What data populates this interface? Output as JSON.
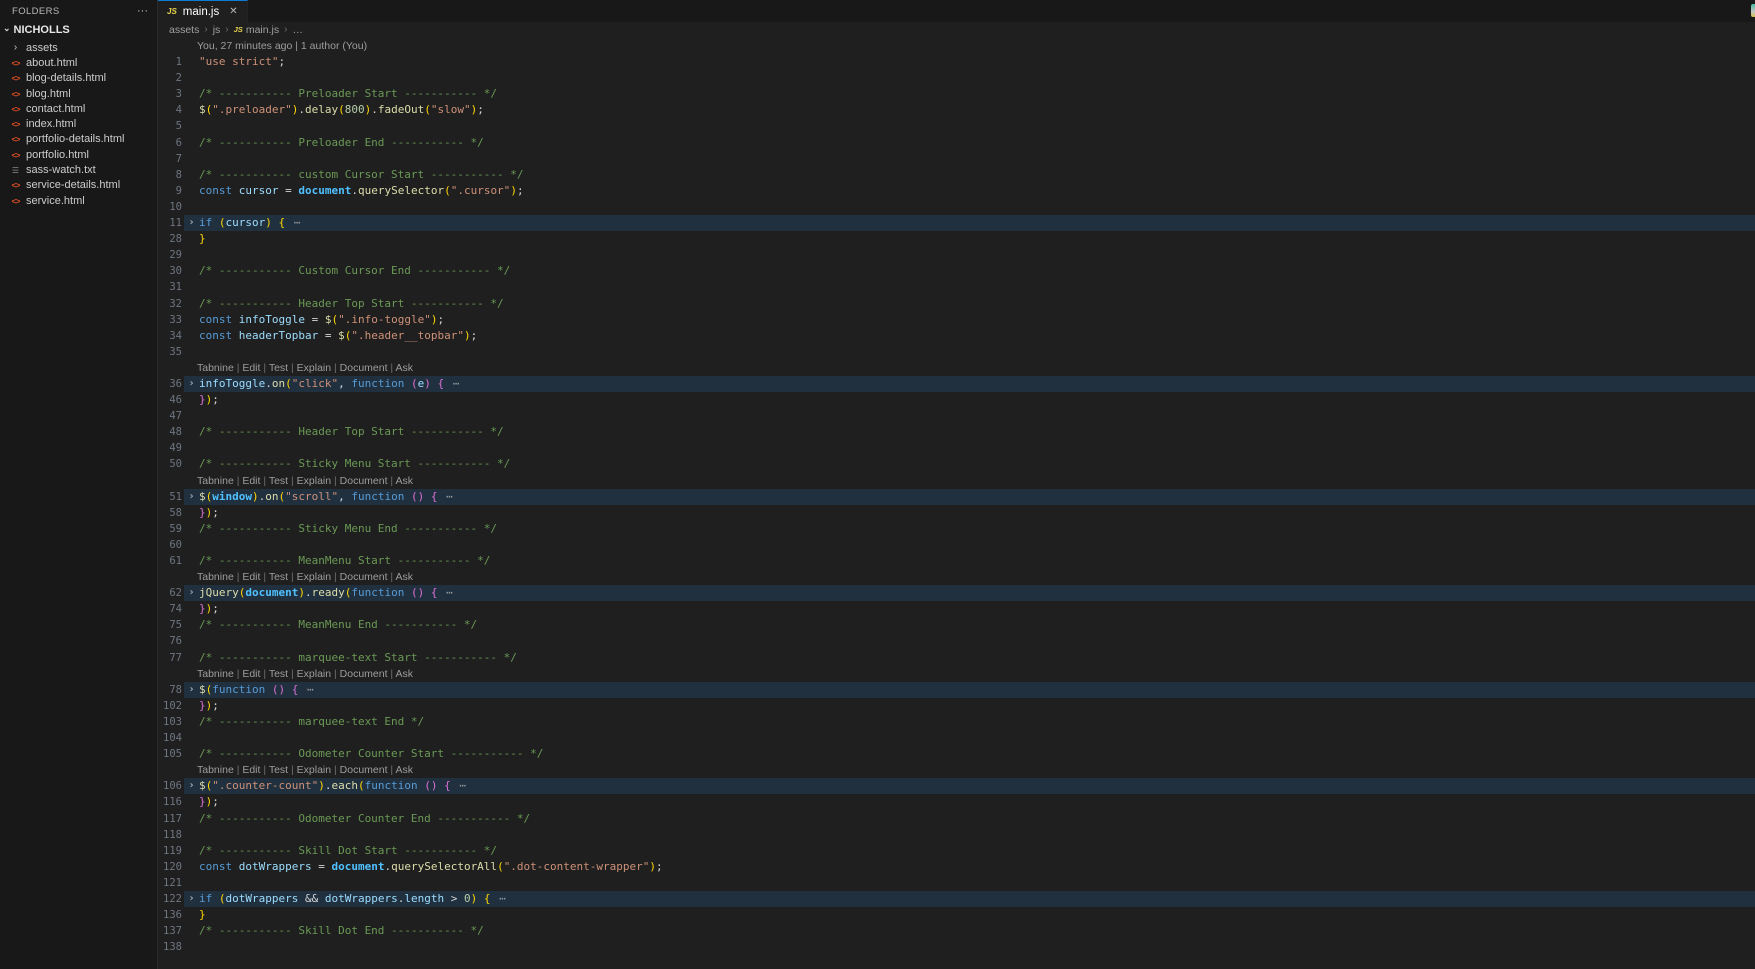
{
  "colors": {
    "accent_blue": "#0c7bd6",
    "editor_bg": "#1f1f1f",
    "sidebar_bg": "#181818",
    "fold_highlight": "rgba(38,79,120,0.37)",
    "keyword": "#569cd6",
    "variable": "#9cdcfe",
    "function": "#dcdcaa",
    "string": "#ce9178",
    "number": "#b5cea8",
    "comment": "#6a9955",
    "bracket1": "#ffd700",
    "bracket2": "#da70d6",
    "html_icon": "#e44d26",
    "js_icon": "#e8d44d",
    "line_number": "#6e7681"
  },
  "sidebar": {
    "header": "FOLDERS",
    "actions_glyph": "···",
    "root_label": "NICHOLLS",
    "root_chevron": "⌄",
    "items": [
      {
        "label": "assets",
        "type": "folder"
      },
      {
        "label": "about.html",
        "type": "html"
      },
      {
        "label": "blog-details.html",
        "type": "html"
      },
      {
        "label": "blog.html",
        "type": "html"
      },
      {
        "label": "contact.html",
        "type": "html"
      },
      {
        "label": "index.html",
        "type": "html"
      },
      {
        "label": "portfolio-details.html",
        "type": "html"
      },
      {
        "label": "portfolio.html",
        "type": "html"
      },
      {
        "label": "sass-watch.txt",
        "type": "txt"
      },
      {
        "label": "service-details.html",
        "type": "html"
      },
      {
        "label": "service.html",
        "type": "html"
      }
    ]
  },
  "tab": {
    "icon_text": "JS",
    "label": "main.js",
    "close_glyph": "✕"
  },
  "breadcrumb": {
    "items": [
      "assets",
      "js",
      "main.js",
      "…"
    ],
    "separator": "›"
  },
  "editor": {
    "blame": "You, 27 minutes ago | 1 author (You)",
    "codelens_links": [
      "Tabnine",
      "Edit",
      "Test",
      "Explain",
      "Document",
      "Ask"
    ],
    "codelens_separator": " | ",
    "fold_glyph": "⋯",
    "fold_chevron": "›",
    "lines": [
      {
        "meta": "blame"
      },
      {
        "n": 1,
        "t": [
          [
            "str",
            "\"use strict\""
          ],
          [
            "pun",
            ";"
          ]
        ]
      },
      {
        "n": 2,
        "t": []
      },
      {
        "n": 3,
        "t": [
          [
            "cmt",
            "/* ----------- Preloader Start ----------- */"
          ]
        ]
      },
      {
        "n": 4,
        "t": [
          [
            "fn",
            "$"
          ],
          [
            "b1",
            "("
          ],
          [
            "str",
            "\".preloader\""
          ],
          [
            "b1",
            ")"
          ],
          [
            "pun",
            "."
          ],
          [
            "fn",
            "delay"
          ],
          [
            "b1",
            "("
          ],
          [
            "num",
            "800"
          ],
          [
            "b1",
            ")"
          ],
          [
            "pun",
            "."
          ],
          [
            "fn",
            "fadeOut"
          ],
          [
            "b1",
            "("
          ],
          [
            "str",
            "\"slow\""
          ],
          [
            "b1",
            ")"
          ],
          [
            "pun",
            ";"
          ]
        ]
      },
      {
        "n": 5,
        "t": []
      },
      {
        "n": 6,
        "t": [
          [
            "cmt",
            "/* ----------- Preloader End ----------- */"
          ]
        ]
      },
      {
        "n": 7,
        "t": []
      },
      {
        "n": 8,
        "t": [
          [
            "cmt",
            "/* ----------- custom Cursor Start ----------- */"
          ]
        ]
      },
      {
        "n": 9,
        "t": [
          [
            "kw",
            "const "
          ],
          [
            "var",
            "cursor"
          ],
          [
            "pun",
            " = "
          ],
          [
            "glb",
            "document"
          ],
          [
            "pun",
            "."
          ],
          [
            "fn",
            "querySelector"
          ],
          [
            "b1",
            "("
          ],
          [
            "str",
            "\".cursor\""
          ],
          [
            "b1",
            ")"
          ],
          [
            "pun",
            ";"
          ]
        ]
      },
      {
        "n": 10,
        "t": []
      },
      {
        "n": 11,
        "hl": 1,
        "fold": 1,
        "t": [
          [
            "kw",
            "if "
          ],
          [
            "b1",
            "("
          ],
          [
            "var",
            "cursor"
          ],
          [
            "b1",
            ")"
          ],
          [
            "pun",
            " "
          ],
          [
            "b1",
            "{"
          ],
          [
            "fold",
            " ⋯"
          ]
        ]
      },
      {
        "n": 28,
        "t": [
          [
            "b1",
            "}"
          ]
        ]
      },
      {
        "n": 29,
        "t": []
      },
      {
        "n": 30,
        "t": [
          [
            "cmt",
            "/* ----------- Custom Cursor End ----------- */"
          ]
        ]
      },
      {
        "n": 31,
        "t": []
      },
      {
        "n": 32,
        "t": [
          [
            "cmt",
            "/* ----------- Header Top Start ----------- */"
          ]
        ]
      },
      {
        "n": 33,
        "t": [
          [
            "kw",
            "const "
          ],
          [
            "var",
            "infoToggle"
          ],
          [
            "pun",
            " = "
          ],
          [
            "fn",
            "$"
          ],
          [
            "b1",
            "("
          ],
          [
            "str",
            "\".info-toggle\""
          ],
          [
            "b1",
            ")"
          ],
          [
            "pun",
            ";"
          ]
        ]
      },
      {
        "n": 34,
        "t": [
          [
            "kw",
            "const "
          ],
          [
            "var",
            "headerTopbar"
          ],
          [
            "pun",
            " = "
          ],
          [
            "fn",
            "$"
          ],
          [
            "b1",
            "("
          ],
          [
            "str",
            "\".header__topbar\""
          ],
          [
            "b1",
            ")"
          ],
          [
            "pun",
            ";"
          ]
        ]
      },
      {
        "n": 35,
        "t": []
      },
      {
        "meta": "lens"
      },
      {
        "n": 36,
        "hl": 1,
        "fold": 1,
        "t": [
          [
            "var",
            "infoToggle"
          ],
          [
            "pun",
            "."
          ],
          [
            "fn",
            "on"
          ],
          [
            "b1",
            "("
          ],
          [
            "str",
            "\"click\""
          ],
          [
            "pun",
            ", "
          ],
          [
            "kw",
            "function "
          ],
          [
            "b2",
            "("
          ],
          [
            "var",
            "e"
          ],
          [
            "b2",
            ")"
          ],
          [
            "pun",
            " "
          ],
          [
            "b2",
            "{"
          ],
          [
            "fold",
            " ⋯"
          ]
        ]
      },
      {
        "n": 46,
        "t": [
          [
            "b2",
            "}"
          ],
          [
            "b1",
            ")"
          ],
          [
            "pun",
            ";"
          ]
        ]
      },
      {
        "n": 47,
        "t": []
      },
      {
        "n": 48,
        "t": [
          [
            "cmt",
            "/* ----------- Header Top Start ----------- */"
          ]
        ]
      },
      {
        "n": 49,
        "t": []
      },
      {
        "n": 50,
        "t": [
          [
            "cmt",
            "/* ----------- Sticky Menu Start ----------- */"
          ]
        ]
      },
      {
        "meta": "lens"
      },
      {
        "n": 51,
        "hl": 1,
        "fold": 1,
        "t": [
          [
            "fn",
            "$"
          ],
          [
            "b1",
            "("
          ],
          [
            "glb",
            "window"
          ],
          [
            "b1",
            ")"
          ],
          [
            "pun",
            "."
          ],
          [
            "fn",
            "on"
          ],
          [
            "b1",
            "("
          ],
          [
            "str",
            "\"scroll\""
          ],
          [
            "pun",
            ", "
          ],
          [
            "kw",
            "function "
          ],
          [
            "b2",
            "()"
          ],
          [
            "pun",
            " "
          ],
          [
            "b2",
            "{"
          ],
          [
            "fold",
            " ⋯"
          ]
        ]
      },
      {
        "n": 58,
        "t": [
          [
            "b2",
            "}"
          ],
          [
            "b1",
            ")"
          ],
          [
            "pun",
            ";"
          ]
        ]
      },
      {
        "n": 59,
        "t": [
          [
            "cmt",
            "/* ----------- Sticky Menu End ----------- */"
          ]
        ]
      },
      {
        "n": 60,
        "t": []
      },
      {
        "n": 61,
        "t": [
          [
            "cmt",
            "/* ----------- MeanMenu Start ----------- */"
          ]
        ]
      },
      {
        "meta": "lens"
      },
      {
        "n": 62,
        "hl": 1,
        "fold": 1,
        "t": [
          [
            "fn",
            "jQuery"
          ],
          [
            "b1",
            "("
          ],
          [
            "glb",
            "document"
          ],
          [
            "b1",
            ")"
          ],
          [
            "pun",
            "."
          ],
          [
            "fn",
            "ready"
          ],
          [
            "b1",
            "("
          ],
          [
            "kw",
            "function "
          ],
          [
            "b2",
            "()"
          ],
          [
            "pun",
            " "
          ],
          [
            "b2",
            "{"
          ],
          [
            "fold",
            " ⋯"
          ]
        ]
      },
      {
        "n": 74,
        "t": [
          [
            "b2",
            "}"
          ],
          [
            "b1",
            ")"
          ],
          [
            "pun",
            ";"
          ]
        ]
      },
      {
        "n": 75,
        "t": [
          [
            "cmt",
            "/* ----------- MeanMenu End ----------- */"
          ]
        ]
      },
      {
        "n": 76,
        "t": []
      },
      {
        "n": 77,
        "t": [
          [
            "cmt",
            "/* ----------- marquee-text Start ----------- */"
          ]
        ]
      },
      {
        "meta": "lens"
      },
      {
        "n": 78,
        "hl": 1,
        "fold": 1,
        "t": [
          [
            "fn",
            "$"
          ],
          [
            "b1",
            "("
          ],
          [
            "kw",
            "function "
          ],
          [
            "b2",
            "()"
          ],
          [
            "pun",
            " "
          ],
          [
            "b2",
            "{"
          ],
          [
            "fold",
            " ⋯"
          ]
        ]
      },
      {
        "n": 102,
        "t": [
          [
            "b2",
            "}"
          ],
          [
            "b1",
            ")"
          ],
          [
            "pun",
            ";"
          ]
        ]
      },
      {
        "n": 103,
        "t": [
          [
            "cmt",
            "/* ----------- marquee-text End */"
          ]
        ]
      },
      {
        "n": 104,
        "t": []
      },
      {
        "n": 105,
        "t": [
          [
            "cmt",
            "/* ----------- Odometer Counter Start ----------- */"
          ]
        ]
      },
      {
        "meta": "lens"
      },
      {
        "n": 106,
        "hl": 1,
        "fold": 1,
        "t": [
          [
            "fn",
            "$"
          ],
          [
            "b1",
            "("
          ],
          [
            "str",
            "\".counter-count\""
          ],
          [
            "b1",
            ")"
          ],
          [
            "pun",
            "."
          ],
          [
            "fn",
            "each"
          ],
          [
            "b1",
            "("
          ],
          [
            "kw",
            "function "
          ],
          [
            "b2",
            "()"
          ],
          [
            "pun",
            " "
          ],
          [
            "b2",
            "{"
          ],
          [
            "fold",
            " ⋯"
          ]
        ]
      },
      {
        "n": 116,
        "t": [
          [
            "b2",
            "}"
          ],
          [
            "b1",
            ")"
          ],
          [
            "pun",
            ";"
          ]
        ]
      },
      {
        "n": 117,
        "t": [
          [
            "cmt",
            "/* ----------- Odometer Counter End ----------- */"
          ]
        ]
      },
      {
        "n": 118,
        "t": []
      },
      {
        "n": 119,
        "t": [
          [
            "cmt",
            "/* ----------- Skill Dot Start ----------- */"
          ]
        ]
      },
      {
        "n": 120,
        "t": [
          [
            "kw",
            "const "
          ],
          [
            "var",
            "dotWrappers"
          ],
          [
            "pun",
            " = "
          ],
          [
            "glb",
            "document"
          ],
          [
            "pun",
            "."
          ],
          [
            "fn",
            "querySelectorAll"
          ],
          [
            "b1",
            "("
          ],
          [
            "str",
            "\".dot-content-wrapper\""
          ],
          [
            "b1",
            ")"
          ],
          [
            "pun",
            ";"
          ]
        ]
      },
      {
        "n": 121,
        "t": []
      },
      {
        "n": 122,
        "hl": 1,
        "fold": 1,
        "t": [
          [
            "kw",
            "if "
          ],
          [
            "b1",
            "("
          ],
          [
            "var",
            "dotWrappers"
          ],
          [
            "pun",
            " && "
          ],
          [
            "var",
            "dotWrappers"
          ],
          [
            "pun",
            "."
          ],
          [
            "var",
            "length"
          ],
          [
            "pun",
            " > "
          ],
          [
            "num",
            "0"
          ],
          [
            "b1",
            ")"
          ],
          [
            "pun",
            " "
          ],
          [
            "b1",
            "{"
          ],
          [
            "fold",
            " ⋯"
          ]
        ]
      },
      {
        "n": 136,
        "t": [
          [
            "b1",
            "}"
          ]
        ]
      },
      {
        "n": 137,
        "t": [
          [
            "cmt",
            "/* ----------- Skill Dot End ----------- */"
          ]
        ]
      },
      {
        "n": 138,
        "t": []
      }
    ]
  }
}
